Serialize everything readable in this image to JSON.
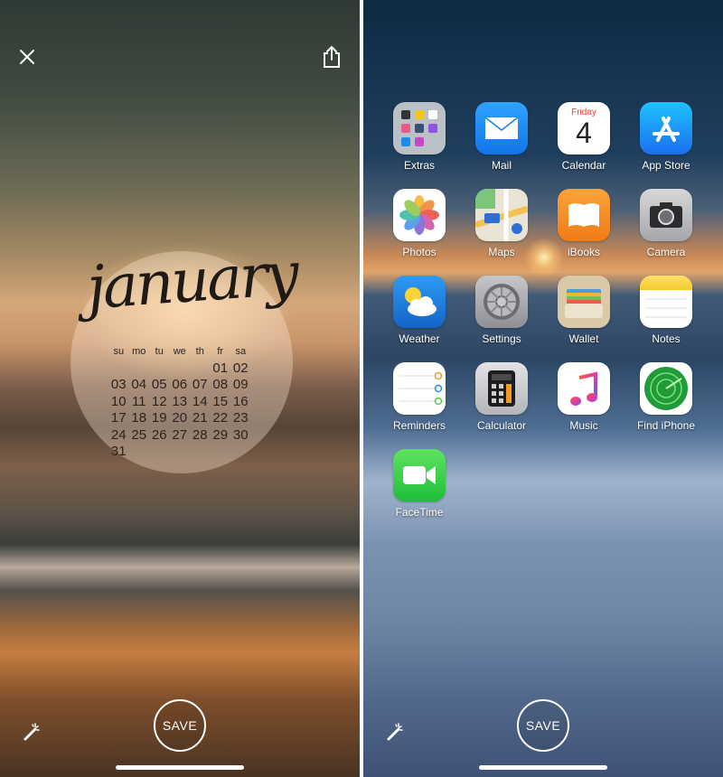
{
  "left_screen": {
    "close_label": "Close",
    "share_label": "Share",
    "save_label": "SAVE",
    "calendar": {
      "month": "january",
      "weekdays": [
        "su",
        "mo",
        "tu",
        "we",
        "th",
        "fr",
        "sa"
      ],
      "weeks": [
        [
          "",
          "",
          "",
          "",
          "",
          "01",
          "02"
        ],
        [
          "03",
          "04",
          "05",
          "06",
          "07",
          "08",
          "09"
        ],
        [
          "10",
          "11",
          "12",
          "13",
          "14",
          "15",
          "16"
        ],
        [
          "17",
          "18",
          "19",
          "20",
          "21",
          "22",
          "23"
        ],
        [
          "24",
          "25",
          "26",
          "27",
          "28",
          "29",
          "30"
        ],
        [
          "31",
          "",
          "",
          "",
          "",
          "",
          ""
        ]
      ]
    }
  },
  "right_screen": {
    "save_label": "SAVE",
    "calendar_icon": {
      "weekday": "Friday",
      "day": "4"
    },
    "apps": [
      {
        "label": "Extras"
      },
      {
        "label": "Mail"
      },
      {
        "label": "Calendar"
      },
      {
        "label": "App Store"
      },
      {
        "label": "Photos"
      },
      {
        "label": "Maps"
      },
      {
        "label": "iBooks"
      },
      {
        "label": "Camera"
      },
      {
        "label": "Weather"
      },
      {
        "label": "Settings"
      },
      {
        "label": "Wallet"
      },
      {
        "label": "Notes"
      },
      {
        "label": "Reminders"
      },
      {
        "label": "Calculator"
      },
      {
        "label": "Music"
      },
      {
        "label": "Find iPhone"
      },
      {
        "label": "FaceTime"
      }
    ]
  },
  "colors": {
    "accent_white": "#ffffff",
    "mail_blue": "#1f8ef1",
    "facetime_green": "#3ecf4c",
    "ibooks_orange": "#f7931e"
  }
}
